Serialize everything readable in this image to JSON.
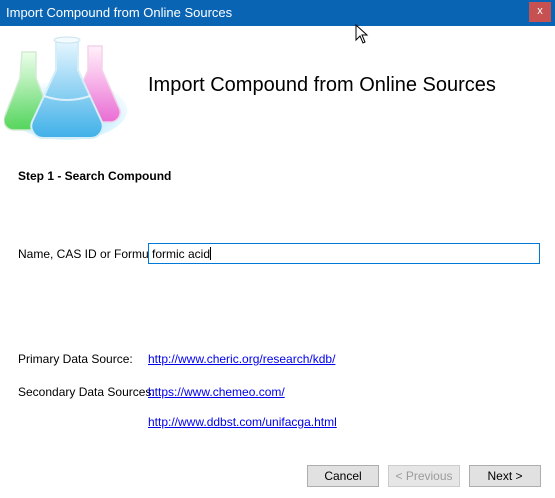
{
  "window": {
    "title": "Import Compound from Online Sources",
    "close_glyph": "x"
  },
  "header": {
    "title": "Import Compound from Online Sources",
    "logo_icon": "chemistry-flasks-icon"
  },
  "step": {
    "title": "Step 1 - Search Compound"
  },
  "search": {
    "label": "Name, CAS ID or Formula",
    "value": "formic acid"
  },
  "sources": {
    "primary_label": "Primary Data Source:",
    "primary_link": "http://www.cheric.org/research/kdb/",
    "secondary_label": "Secondary Data Sources:",
    "secondary_links": [
      "https://www.chemeo.com/",
      "http://www.ddbst.com/unifacga.html"
    ]
  },
  "buttons": {
    "cancel": "Cancel",
    "previous": "< Previous",
    "next": "Next >"
  },
  "colors": {
    "titlebar": "#0a64b4",
    "close_button": "#c75050",
    "focus_border": "#0078d7",
    "link": "#0000ee"
  }
}
